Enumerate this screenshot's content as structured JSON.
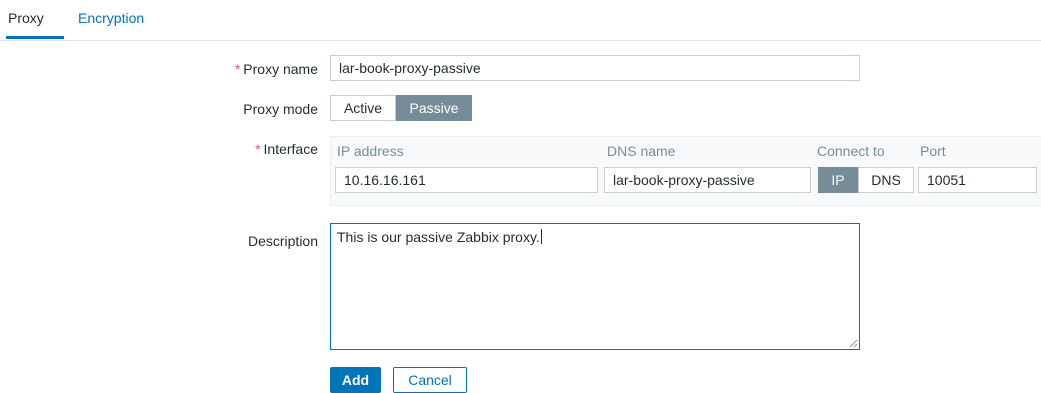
{
  "tabs": [
    {
      "label": "Proxy",
      "active": true
    },
    {
      "label": "Encryption",
      "active": false
    }
  ],
  "form": {
    "proxy_name": {
      "label": "Proxy name",
      "required_mark": "*",
      "value": "lar-book-proxy-passive"
    },
    "proxy_mode": {
      "label": "Proxy mode",
      "options": [
        "Active",
        "Passive"
      ],
      "selected": "Passive"
    },
    "interface": {
      "label": "Interface",
      "required_mark": "*",
      "headers": {
        "ip": "IP address",
        "dns": "DNS name",
        "connect": "Connect to",
        "port": "Port"
      },
      "ip_value": "10.16.16.161",
      "dns_value": "lar-book-proxy-passive",
      "connect_options": [
        "IP",
        "DNS"
      ],
      "connect_selected": "IP",
      "port_value": "10051"
    },
    "description": {
      "label": "Description",
      "value": "This is our passive Zabbix proxy."
    }
  },
  "buttons": {
    "add": "Add",
    "cancel": "Cancel"
  },
  "colors": {
    "accent": "#0275b8",
    "segment_active": "#768d99",
    "required": "#e45959"
  }
}
